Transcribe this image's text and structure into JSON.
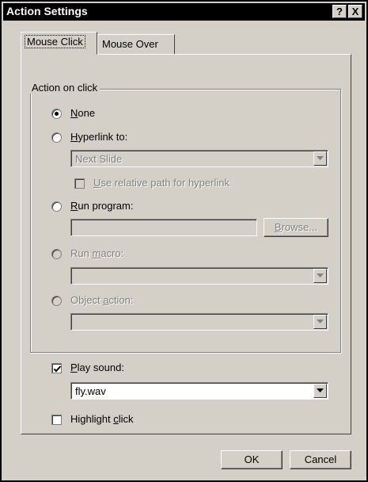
{
  "window": {
    "title": "Action Settings",
    "help_btn": "?",
    "close_btn": "X"
  },
  "tabs": [
    {
      "label": "Mouse Click"
    },
    {
      "label": "Mouse Over"
    }
  ],
  "group": {
    "legend": "Action on click"
  },
  "options": {
    "none": {
      "label": "None"
    },
    "hyperlink": {
      "label": "Hyperlink to:",
      "value": "Next Slide"
    },
    "relative_path": {
      "label": "Use relative path for hyperlink"
    },
    "run_program": {
      "label": "Run program:",
      "browse": "Browse..."
    },
    "run_macro": {
      "label": "Run macro:"
    },
    "object_action": {
      "label": "Object action:"
    }
  },
  "sound": {
    "label": "Play sound:",
    "value": "fly.wav"
  },
  "highlight": {
    "label": "Highlight click"
  },
  "footer": {
    "ok": "OK",
    "cancel": "Cancel"
  }
}
